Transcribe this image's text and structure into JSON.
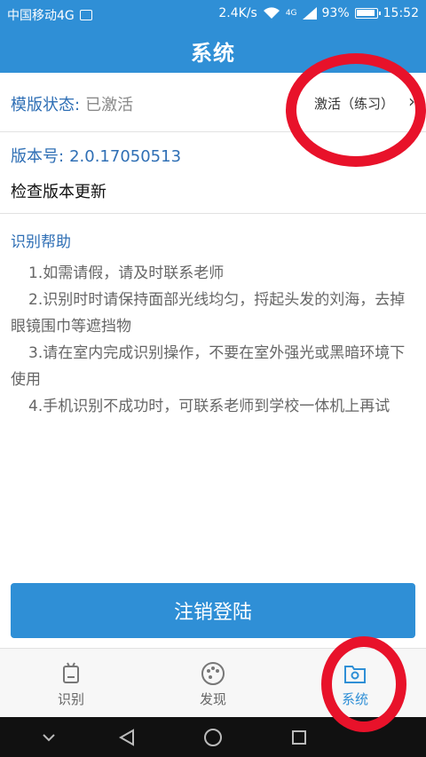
{
  "status_bar": {
    "carrier": "中国移动4G",
    "speed": "2.4K/s",
    "network": "4G",
    "battery": "93%",
    "time": "15:52"
  },
  "header": {
    "title": "系统"
  },
  "template": {
    "label": "模版状态:",
    "value": "已激活",
    "action": "激活（练习）"
  },
  "version": {
    "label": "版本号:",
    "value": "2.0.17050513"
  },
  "update": {
    "label": "检查版本更新"
  },
  "help": {
    "title": "识别帮助",
    "items": [
      "1.如需请假，请及时联系老师",
      "2.识别时时请保持面部光线均匀，捋起头发的刘海，去掉眼镜围巾等遮挡物",
      "3.请在室内完成识别操作，不要在室外强光或黑暗环境下使用",
      "4.手机识别不成功时，可联系老师到学校一体机上再试"
    ]
  },
  "logout": {
    "label": "注销登陆"
  },
  "tabs": [
    {
      "label": "识别",
      "icon": "robot-icon"
    },
    {
      "label": "发现",
      "icon": "palette-icon"
    },
    {
      "label": "系统",
      "icon": "settings-folder-icon"
    }
  ],
  "colors": {
    "primary": "#2f8fd6",
    "accent_text": "#2f6fb5",
    "annotation": "#e8122a"
  }
}
